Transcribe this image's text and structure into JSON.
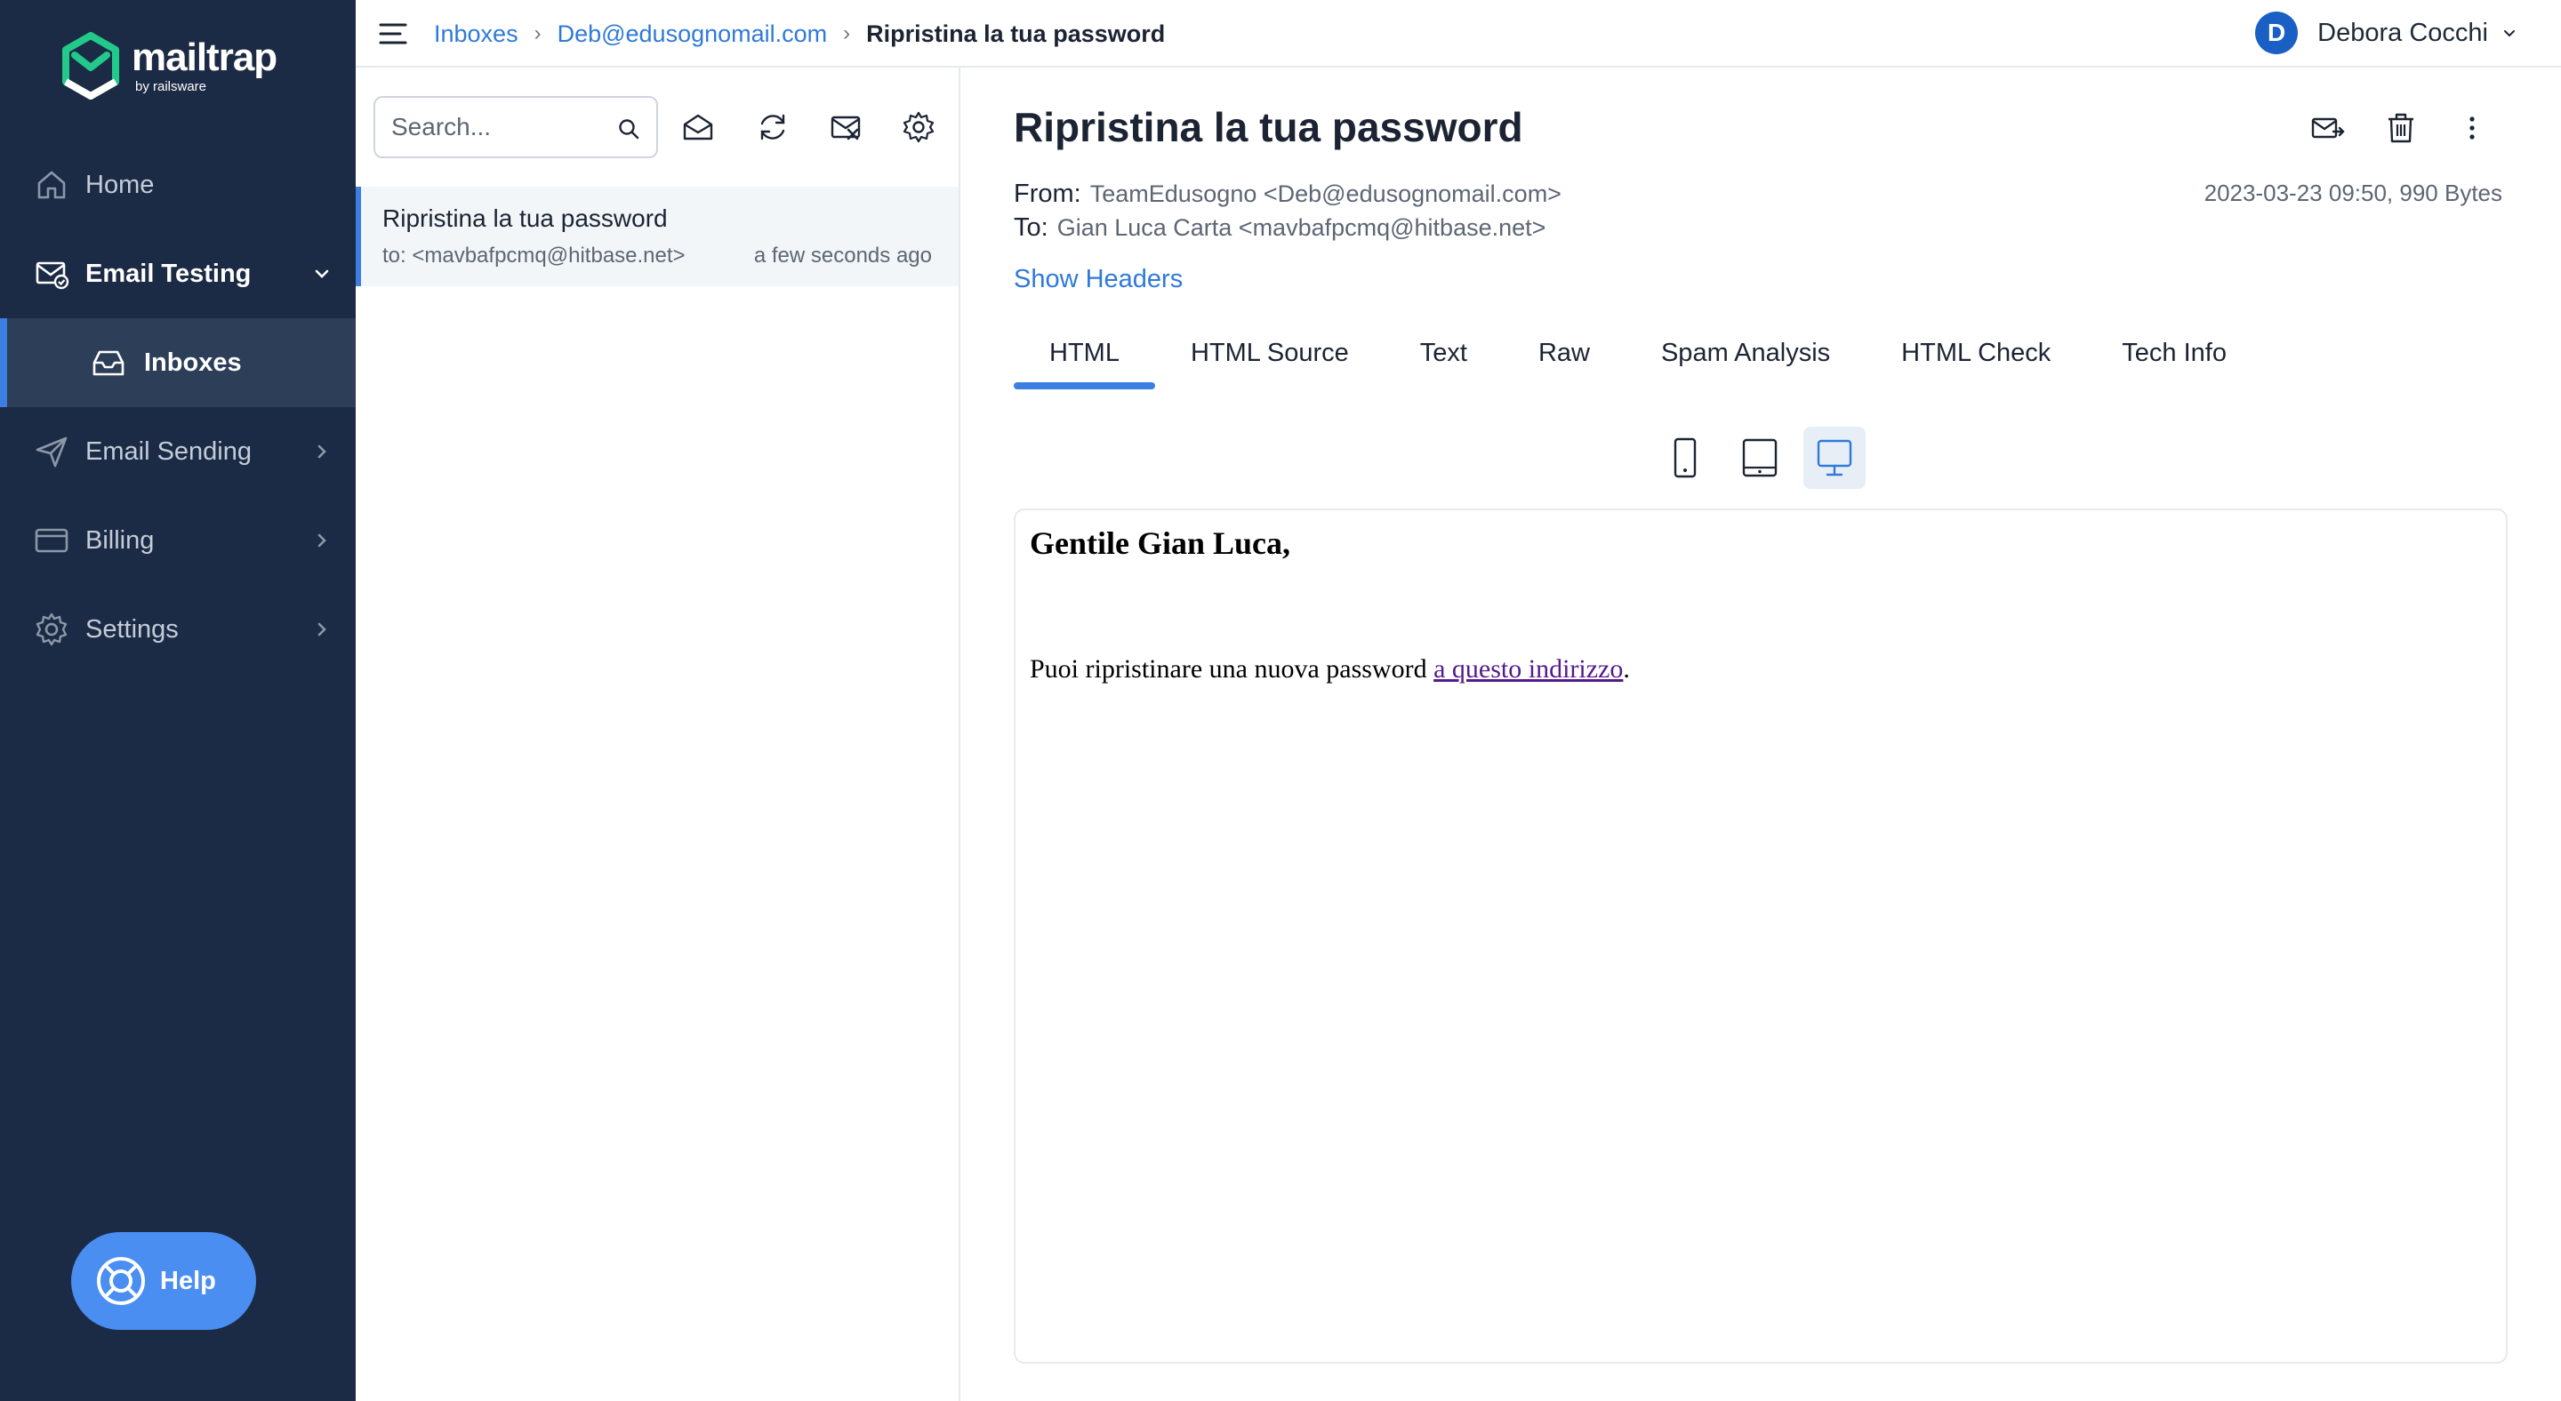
{
  "app": {
    "logo_name": "mailtrap",
    "logo_sub": "by railsware",
    "brand_color": "#22c98a",
    "sidebar_bg": "#1c2b45",
    "accent": "#3d7fe0"
  },
  "sidebar": {
    "items": [
      {
        "label": "Home",
        "icon": "home-icon"
      },
      {
        "label": "Email Testing",
        "icon": "envelope-check-icon",
        "expanded": true
      },
      {
        "label": "Inboxes",
        "icon": "inbox-icon",
        "selected": true
      },
      {
        "label": "Email Sending",
        "icon": "paper-plane-icon"
      },
      {
        "label": "Billing",
        "icon": "credit-card-icon"
      },
      {
        "label": "Settings",
        "icon": "gear-icon"
      }
    ],
    "help_label": "Help"
  },
  "topbar": {
    "breadcrumb": [
      "Inboxes",
      "Deb@edusognomail.com",
      "Ripristina la tua password"
    ],
    "user_initial": "D",
    "user_name": "Debora Cocchi"
  },
  "list": {
    "search_placeholder": "Search...",
    "messages": [
      {
        "subject": "Ripristina la tua password",
        "to": "to: <mavbafpcmq@hitbase.net>",
        "time": "a few seconds ago"
      }
    ]
  },
  "message": {
    "subject": "Ripristina la tua password",
    "from_label": "From:",
    "from": "TeamEdusogno <Deb@edusognomail.com>",
    "to_label": "To:",
    "to": "Gian Luca Carta <mavbafpcmq@hitbase.net>",
    "meta": "2023-03-23 09:50, 990 Bytes",
    "show_headers": "Show Headers",
    "tabs": [
      "HTML",
      "HTML Source",
      "Text",
      "Raw",
      "Spam Analysis",
      "HTML Check",
      "Tech Info"
    ],
    "active_tab": "HTML",
    "active_device": "desktop",
    "body": {
      "greeting": "Gentile Gian Luca,",
      "text_before_link": "Puoi ripristinare una nuova password ",
      "link": "a questo indirizzo",
      "text_after_link": "."
    }
  }
}
